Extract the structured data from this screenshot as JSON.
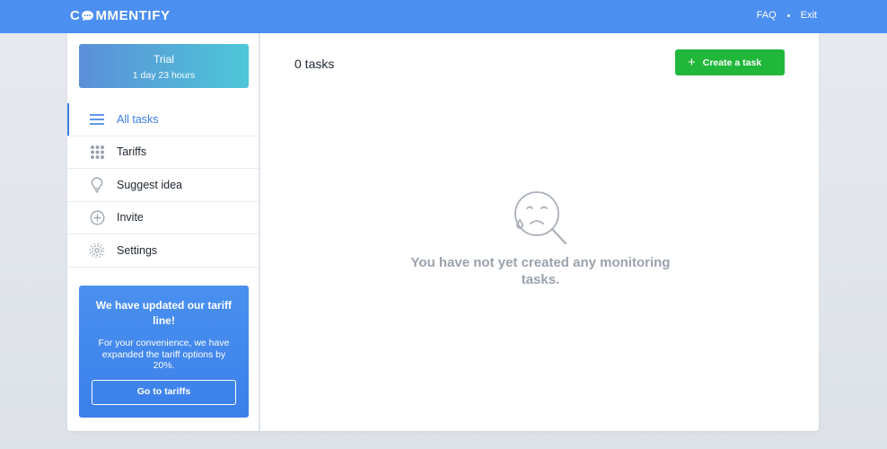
{
  "app": {
    "logo_left": "C",
    "logo_right": "MMENTIFY",
    "brand_color": "#4b8ff0"
  },
  "top_nav": {
    "faq": "FAQ",
    "exit": "Exit"
  },
  "trial": {
    "title": "Trial",
    "remaining": "1 day 23 hours"
  },
  "sidebar": {
    "items": [
      {
        "label": "All tasks",
        "icon": "list-icon",
        "active": true
      },
      {
        "label": "Tariffs",
        "icon": "grid-dots-icon",
        "active": false
      },
      {
        "label": "Suggest idea",
        "icon": "lightbulb-icon",
        "active": false
      },
      {
        "label": "Invite",
        "icon": "plus-circle-icon",
        "active": false
      },
      {
        "label": "Settings",
        "icon": "gear-icon",
        "active": false
      }
    ]
  },
  "promo": {
    "heading": "We have updated our tariff line!",
    "text": "For your convenience, we have expanded the tariff options by 20%.",
    "button": "Go to tariffs"
  },
  "main": {
    "task_count": "0 tasks",
    "create_button": "Create a task",
    "empty_message": "You have not yet created any monitoring tasks.",
    "empty_icon": "sad-magnifier-icon"
  },
  "colors": {
    "accent": "#3a7de6",
    "create_button": "#21b73a",
    "empty_text": "#9aa2ac"
  }
}
